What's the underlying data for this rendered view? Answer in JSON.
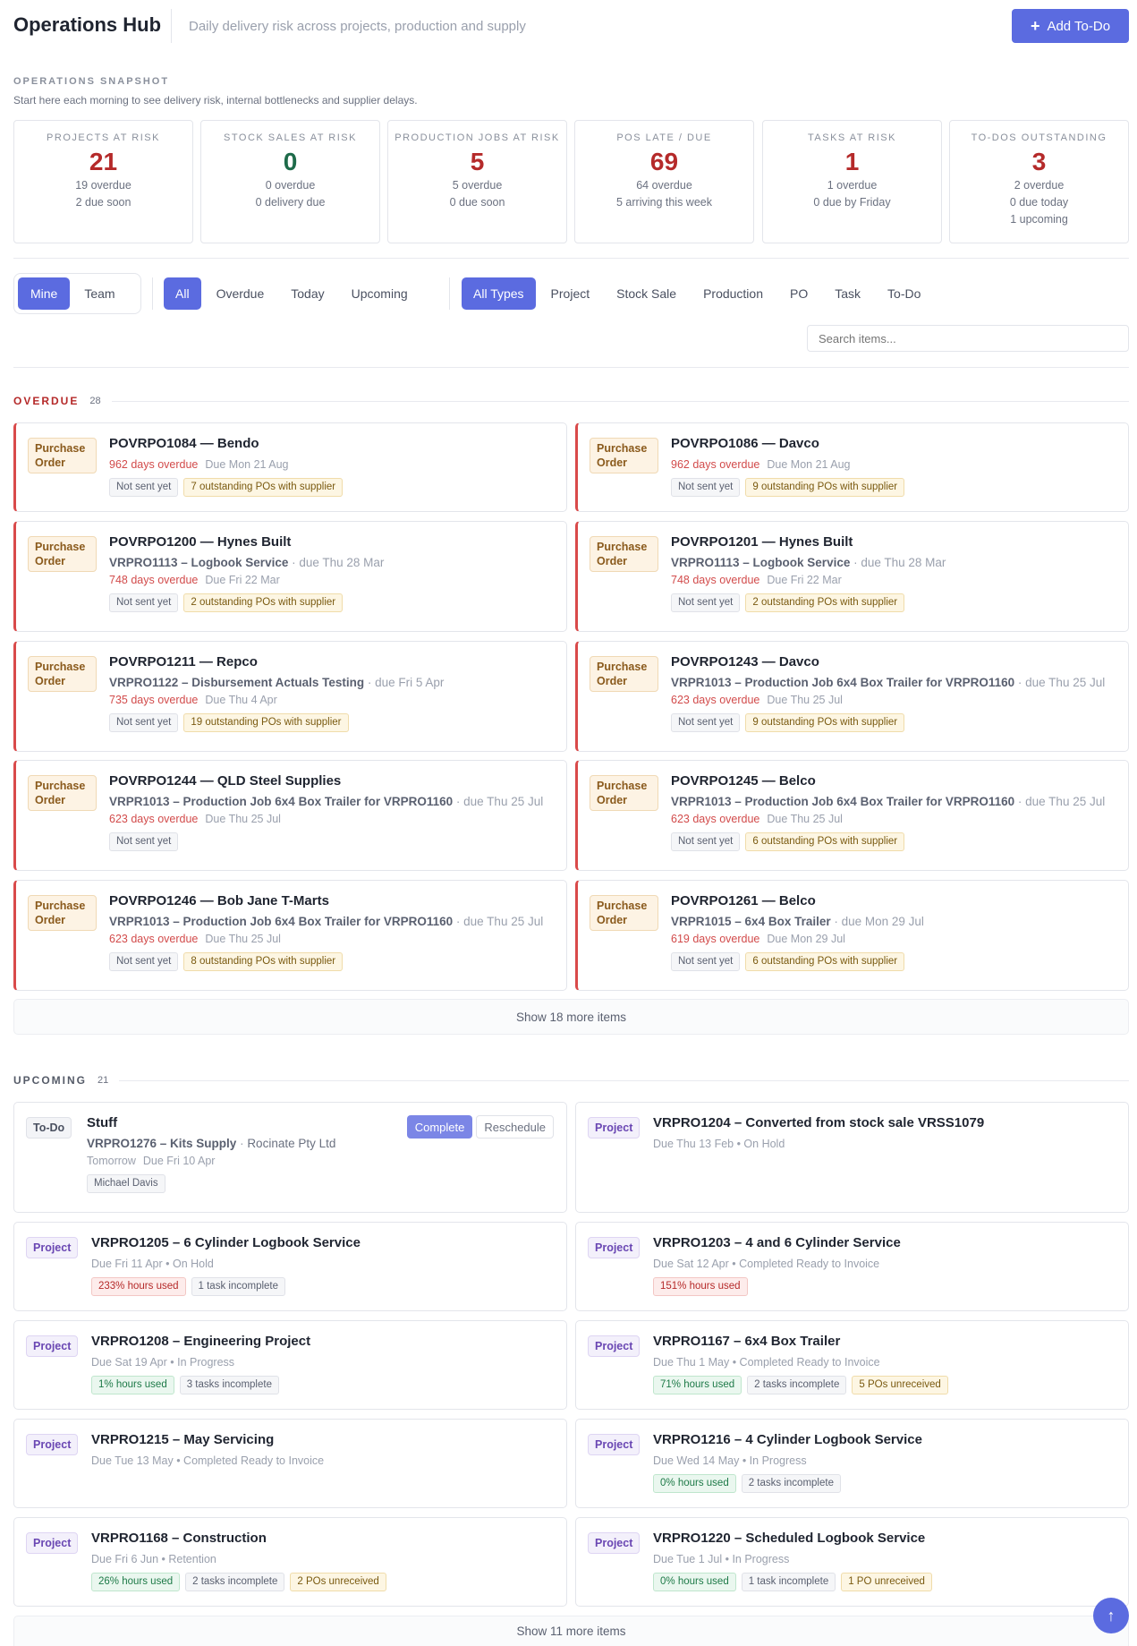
{
  "header": {
    "title": "Operations Hub",
    "subtitle": "Daily delivery risk across projects, production and supply",
    "add_todo": "Add To-Do"
  },
  "snapshot": {
    "label": "OPERATIONS SNAPSHOT",
    "description": "Start here each morning to see delivery risk, internal bottlenecks and supplier delays.",
    "cards": [
      {
        "label": "PROJECTS AT RISK",
        "value": "21",
        "lines": [
          "19 overdue",
          "2 due soon",
          ""
        ]
      },
      {
        "label": "STOCK SALES AT RISK",
        "value": "0",
        "lines": [
          "0 overdue",
          "0 delivery due",
          ""
        ]
      },
      {
        "label": "PRODUCTION JOBS AT RISK",
        "value": "5",
        "lines": [
          "5 overdue",
          "0 due soon",
          ""
        ]
      },
      {
        "label": "POS LATE / DUE",
        "value": "69",
        "lines": [
          "64 overdue",
          "5 arriving this week",
          ""
        ]
      },
      {
        "label": "TASKS AT RISK",
        "value": "1",
        "lines": [
          "1 overdue",
          "0 due by Friday",
          ""
        ]
      },
      {
        "label": "TO-DOS OUTSTANDING",
        "value": "3",
        "lines": [
          "2 overdue",
          "0 due today",
          "1 upcoming"
        ]
      }
    ]
  },
  "filters": {
    "scope": [
      "Mine",
      "Team"
    ],
    "timing": [
      "All",
      "Overdue",
      "Today",
      "Upcoming"
    ],
    "types": [
      "All Types",
      "Project",
      "Stock Sale",
      "Production",
      "PO",
      "Task",
      "To-Do"
    ],
    "search_placeholder": "Search items..."
  },
  "overdue": {
    "title": "OVERDUE",
    "count": "28",
    "items": [
      {
        "badge": "Purchase Order",
        "title": "POVRPO1084 — Bendo",
        "ref": "",
        "ref_due": "",
        "overdue": "962 days overdue",
        "due": "Due Mon 21 Aug",
        "tags": [
          "Not sent yet",
          "7 outstanding POs with supplier"
        ]
      },
      {
        "badge": "Purchase Order",
        "title": "POVRPO1086 — Davco",
        "ref": "",
        "ref_due": "",
        "overdue": "962 days overdue",
        "due": "Due Mon 21 Aug",
        "tags": [
          "Not sent yet",
          "9 outstanding POs with supplier"
        ]
      },
      {
        "badge": "Purchase Order",
        "title": "POVRPO1200 — Hynes Built",
        "ref": "VRPRO1113 – Logbook Service",
        "ref_due": "due Thu 28 Mar",
        "overdue": "748 days overdue",
        "due": "Due Fri 22 Mar",
        "tags": [
          "Not sent yet",
          "2 outstanding POs with supplier"
        ]
      },
      {
        "badge": "Purchase Order",
        "title": "POVRPO1201 — Hynes Built",
        "ref": "VRPRO1113 – Logbook Service",
        "ref_due": "due Thu 28 Mar",
        "overdue": "748 days overdue",
        "due": "Due Fri 22 Mar",
        "tags": [
          "Not sent yet",
          "2 outstanding POs with supplier"
        ]
      },
      {
        "badge": "Purchase Order",
        "title": "POVRPO1211 — Repco",
        "ref": "VRPRO1122 – Disbursement Actuals Testing",
        "ref_due": "due Fri 5 Apr",
        "overdue": "735 days overdue",
        "due": "Due Thu 4 Apr",
        "tags": [
          "Not sent yet",
          "19 outstanding POs with supplier"
        ]
      },
      {
        "badge": "Purchase Order",
        "title": "POVRPO1243 — Davco",
        "ref": "VRPR1013 – Production Job 6x4 Box Trailer for VRPRO1160",
        "ref_due": "due Thu 25 Jul",
        "overdue": "623 days overdue",
        "due": "Due Thu 25 Jul",
        "tags": [
          "Not sent yet",
          "9 outstanding POs with supplier"
        ]
      },
      {
        "badge": "Purchase Order",
        "title": "POVRPO1244 — QLD Steel Supplies",
        "ref": "VRPR1013 – Production Job 6x4 Box Trailer for VRPRO1160",
        "ref_due": "due Thu 25 Jul",
        "overdue": "623 days overdue",
        "due": "Due Thu 25 Jul",
        "tags": [
          "Not sent yet"
        ]
      },
      {
        "badge": "Purchase Order",
        "title": "POVRPO1245 — Belco",
        "ref": "VRPR1013 – Production Job 6x4 Box Trailer for VRPRO1160",
        "ref_due": "due Thu 25 Jul",
        "overdue": "623 days overdue",
        "due": "Due Thu 25 Jul",
        "tags": [
          "Not sent yet",
          "6 outstanding POs with supplier"
        ]
      },
      {
        "badge": "Purchase Order",
        "title": "POVRPO1246 — Bob Jane T-Marts",
        "ref": "VRPR1013 – Production Job 6x4 Box Trailer for VRPRO1160",
        "ref_due": "due Thu 25 Jul",
        "overdue": "623 days overdue",
        "due": "Due Thu 25 Jul",
        "tags": [
          "Not sent yet",
          "8 outstanding POs with supplier"
        ]
      },
      {
        "badge": "Purchase Order",
        "title": "POVRPO1261 — Belco",
        "ref": "VRPR1015 – 6x4 Box Trailer",
        "ref_due": "due Mon 29 Jul",
        "overdue": "619 days overdue",
        "due": "Due Mon 29 Jul",
        "tags": [
          "Not sent yet",
          "6 outstanding POs with supplier"
        ]
      }
    ],
    "show_more": "Show 18 more items"
  },
  "upcoming": {
    "title": "UPCOMING",
    "count": "21",
    "todo": {
      "badge": "To-Do",
      "title": "Stuff",
      "ref": "VRPRO1276 – Kits Supply",
      "ref_extra": "Rocinate Pty Ltd",
      "when": "Tomorrow",
      "due": "Due Fri 10 Apr",
      "assignee": "Michael Davis",
      "complete": "Complete",
      "reschedule": "Reschedule"
    },
    "items": [
      {
        "badge": "Project",
        "title": "VRPRO1204 – Converted from stock sale VRSS1079",
        "meta": "Due Thu 13 Feb • On Hold",
        "tags": []
      },
      {
        "badge": "Project",
        "title": "VRPRO1205 – 6 Cylinder Logbook Service",
        "meta": "Due Fri 11 Apr • On Hold",
        "tags": [
          {
            "t": "233% hours used",
            "c": "red"
          },
          {
            "t": "1 task incomplete",
            "c": ""
          }
        ]
      },
      {
        "badge": "Project",
        "title": "VRPRO1203 – 4 and 6 Cylinder Service",
        "meta": "Due Sat 12 Apr • Completed Ready to Invoice",
        "tags": [
          {
            "t": "151% hours used",
            "c": "red"
          }
        ]
      },
      {
        "badge": "Project",
        "title": "VRPRO1208 – Engineering Project",
        "meta": "Due Sat 19 Apr • In Progress",
        "tags": [
          {
            "t": "1% hours used",
            "c": "green"
          },
          {
            "t": "3 tasks incomplete",
            "c": ""
          }
        ]
      },
      {
        "badge": "Project",
        "title": "VRPRO1167 – 6x4 Box Trailer",
        "meta": "Due Thu 1 May • Completed Ready to Invoice",
        "tags": [
          {
            "t": "71% hours used",
            "c": "green"
          },
          {
            "t": "2 tasks incomplete",
            "c": ""
          },
          {
            "t": "5 POs unreceived",
            "c": "amber"
          }
        ]
      },
      {
        "badge": "Project",
        "title": "VRPRO1215 – May Servicing",
        "meta": "Due Tue 13 May • Completed Ready to Invoice",
        "tags": []
      },
      {
        "badge": "Project",
        "title": "VRPRO1216 – 4 Cylinder Logbook Service",
        "meta": "Due Wed 14 May • In Progress",
        "tags": [
          {
            "t": "0% hours used",
            "c": "green"
          },
          {
            "t": "2 tasks incomplete",
            "c": ""
          }
        ]
      },
      {
        "badge": "Project",
        "title": "VRPRO1168 – Construction",
        "meta": "Due Fri 6 Jun • Retention",
        "tags": [
          {
            "t": "26% hours used",
            "c": "green"
          },
          {
            "t": "2 tasks incomplete",
            "c": ""
          },
          {
            "t": "2 POs unreceived",
            "c": "amber"
          }
        ]
      },
      {
        "badge": "Project",
        "title": "VRPRO1220 – Scheduled Logbook Service",
        "meta": "Due Tue 1 Jul • In Progress",
        "tags": [
          {
            "t": "0% hours used",
            "c": "green"
          },
          {
            "t": "1 task incomplete",
            "c": ""
          },
          {
            "t": "1 PO unreceived",
            "c": "amber"
          }
        ]
      }
    ],
    "show_more": "Show 11 more items"
  },
  "fab_icon": "arrow-up-icon",
  "colors": {
    "accent": "#5b6be0",
    "danger": "#b52a2a",
    "success": "#1e6b4a"
  }
}
